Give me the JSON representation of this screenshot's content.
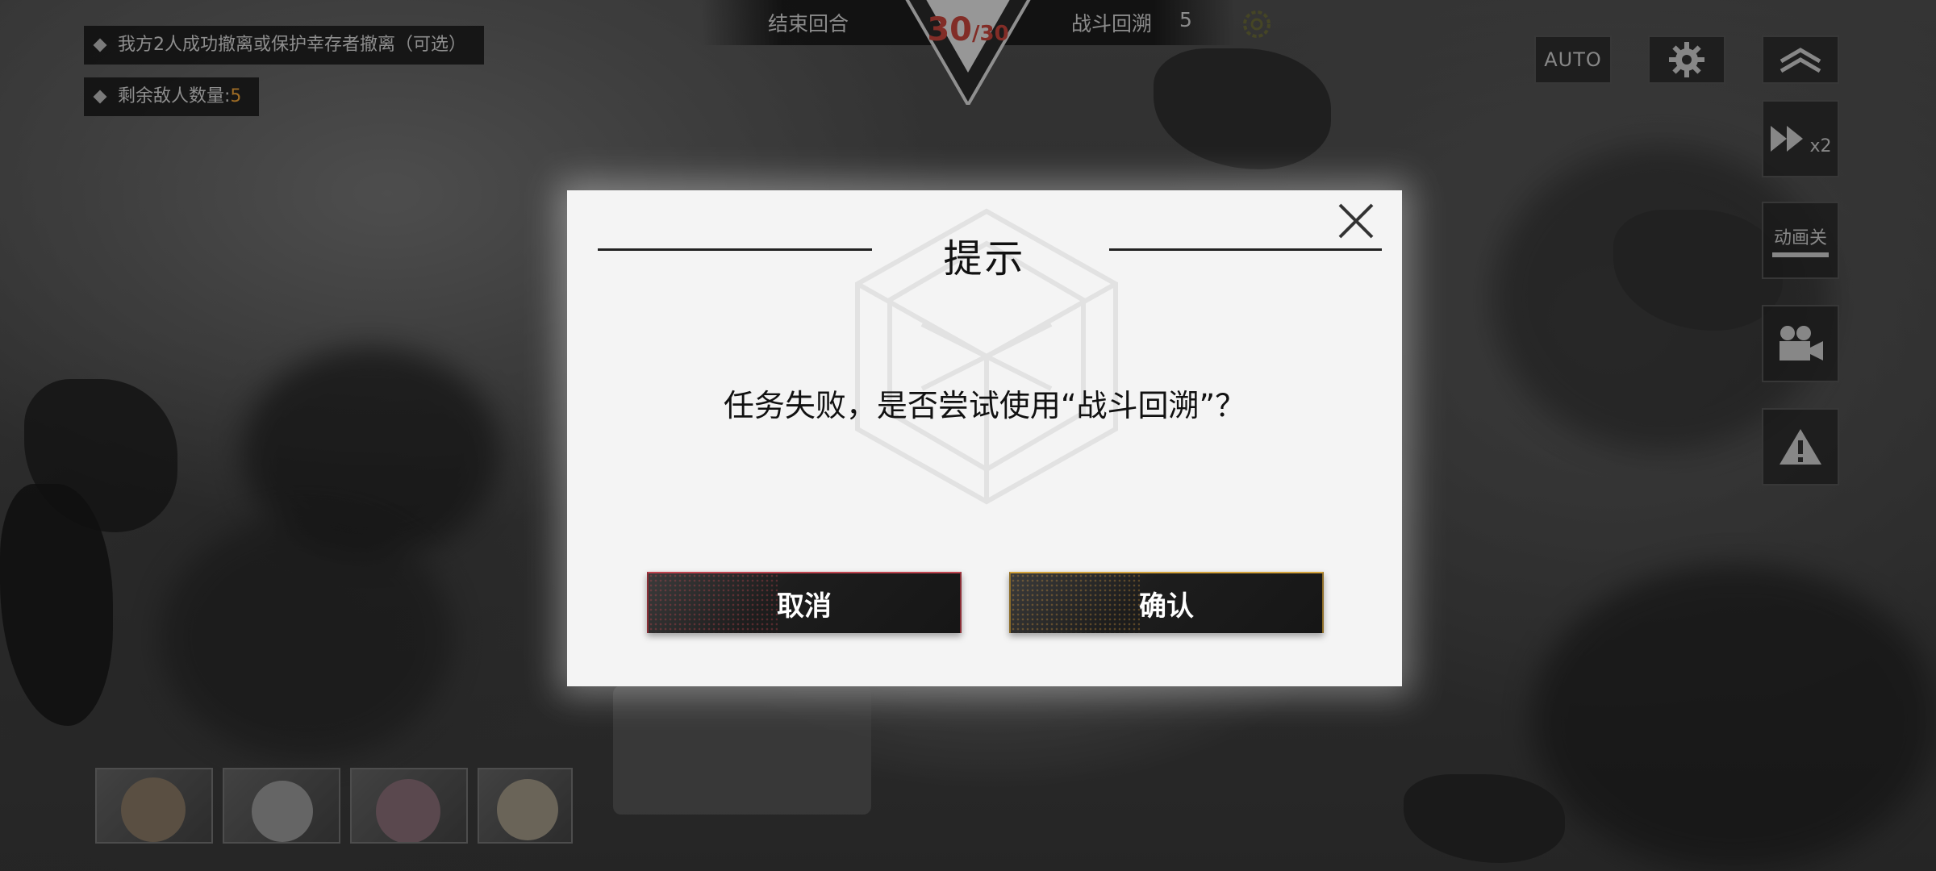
{
  "objectives": {
    "primary": "我方2人成功撤离或保护幸存者撤离（可选）",
    "enemies_label": "剩余敌人数量:",
    "enemies_count": "5"
  },
  "topbar": {
    "end_turn": "结束回合",
    "turn_current": "30",
    "turn_total": "/30",
    "rewind_label": "战斗回溯",
    "rewind_count": "5"
  },
  "right_controls": {
    "auto_label": "AUTO",
    "speed_label": "x2",
    "animation_label": "动画关"
  },
  "dialog": {
    "title": "提示",
    "message": "任务失败，是否尝试使用“战斗回溯”？",
    "cancel_label": "取消",
    "confirm_label": "确认"
  },
  "colors": {
    "enemy_count": "#f3a63a",
    "turn_counter": "#c8463c",
    "cancel_accent": "#c0434e",
    "confirm_accent": "#d4a23a"
  },
  "icons": [
    "gear-icon",
    "collapse-icon",
    "fast-forward-icon",
    "camera-icon",
    "warning-icon",
    "close-icon"
  ]
}
